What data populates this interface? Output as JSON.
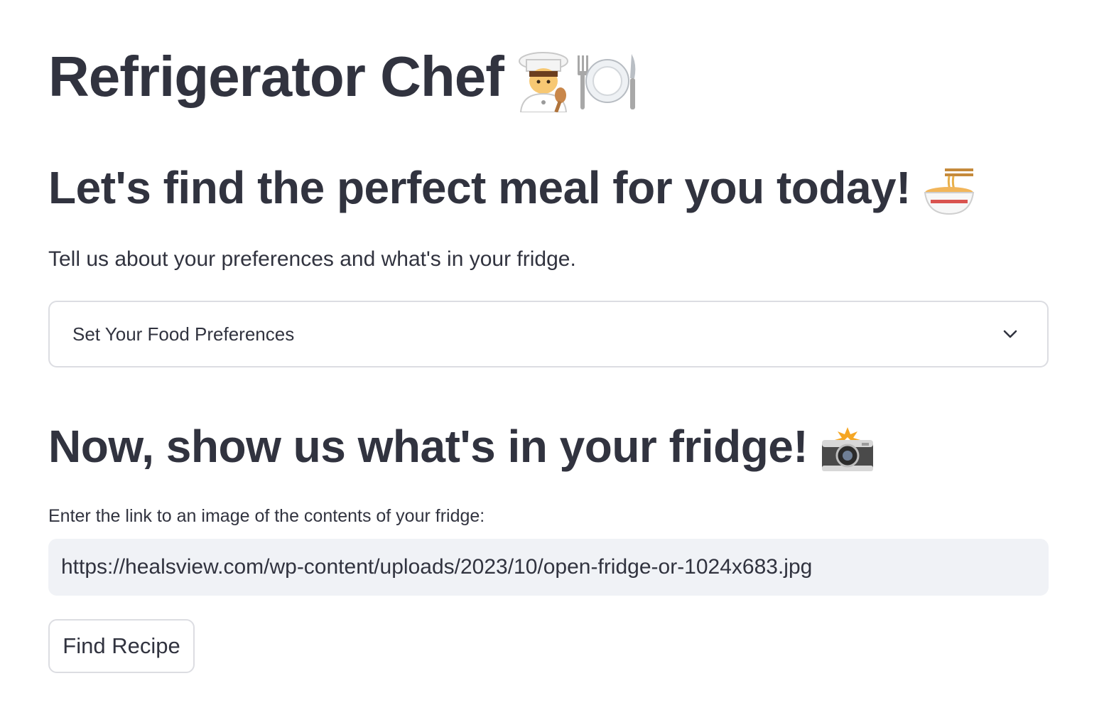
{
  "header": {
    "title": "Refrigerator Chef",
    "title_emoji": "👩‍🍳🍽️"
  },
  "preferences_section": {
    "heading": "Let's find the perfect meal for you today!",
    "heading_emoji": "🍜",
    "intro": "Tell us about your preferences and what's in your fridge.",
    "expander_label": "Set Your Food Preferences",
    "expander_icon": "chevron-down-icon"
  },
  "fridge_section": {
    "heading": "Now, show us what's in your fridge!",
    "heading_emoji": "📸",
    "input_label": "Enter the link to an image of the contents of your fridge:",
    "input_value": "https://healsview.com/wp-content/uploads/2023/10/open-fridge-or-1024x683.jpg"
  },
  "actions": {
    "find_recipe_label": "Find Recipe"
  },
  "colors": {
    "text": "#31333f",
    "border": "#dcdde2",
    "input_background": "#f0f2f6"
  }
}
